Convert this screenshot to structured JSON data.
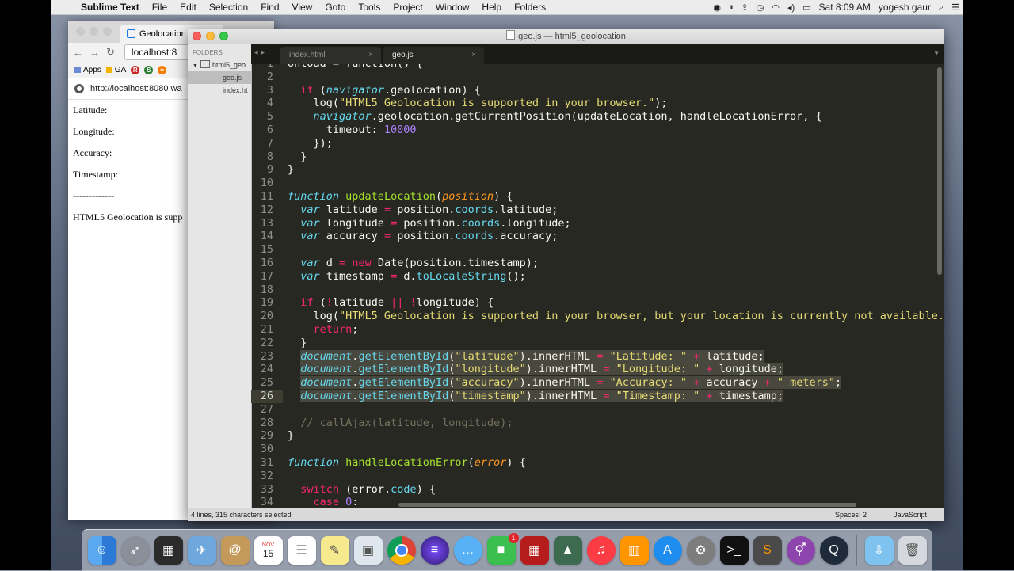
{
  "menubar": {
    "app": "Sublime Text",
    "items": [
      "File",
      "Edit",
      "Selection",
      "Find",
      "View",
      "Goto",
      "Tools",
      "Project",
      "Window",
      "Help",
      "Folders"
    ],
    "clock": "Sat 8:09 AM",
    "user": "yogesh gaur"
  },
  "browser": {
    "tab_title": "Geolocation",
    "url": "localhost:8",
    "bookmarks": {
      "apps": "Apps",
      "ga": "GA"
    },
    "infobar_text": "http://localhost:8080 wa",
    "fields": [
      "Latitude:",
      "Longitude:",
      "Accuracy:",
      "Timestamp:"
    ],
    "divider": "-------------",
    "message": "HTML5 Geolocation is supp"
  },
  "sublime": {
    "title": "geo.js — html5_geolocation",
    "sidebar": {
      "header": "FOLDERS",
      "folder": "html5_geo",
      "files": [
        "geo.js",
        "index.ht"
      ]
    },
    "tabs": [
      "index.html",
      "geo.js"
    ],
    "active_tab": "geo.js",
    "status": {
      "selection": "4 lines, 315 characters selected",
      "spaces": "Spaces: 2",
      "syntax": "JavaScript"
    },
    "line_numbers": [
      "1",
      "2",
      "3",
      "4",
      "5",
      "6",
      "7",
      "8",
      "9",
      "10",
      "11",
      "12",
      "13",
      "14",
      "15",
      "16",
      "17",
      "18",
      "19",
      "20",
      "21",
      "22",
      "23",
      "24",
      "25",
      "26",
      "27",
      "28",
      "29",
      "30",
      "31",
      "32",
      "33",
      "34"
    ]
  },
  "colors": {
    "editor_bg": "#272822",
    "keyword": "#f92672",
    "string": "#e6db74",
    "number": "#ae81ff",
    "function": "#a6e22e",
    "builtin": "#66d9ef",
    "comment": "#75715e"
  },
  "dock": {
    "icons": [
      "finder-icon",
      "launchpad-icon",
      "mission-control-icon",
      "preview-icon",
      "contacts-icon",
      "calendar-icon",
      "reminders-icon",
      "notes-icon",
      "photo-icon",
      "chrome-icon",
      "eclipse-icon",
      "messages-icon",
      "facetime-icon",
      "photo-booth-icon",
      "image-capture-icon",
      "itunes-icon",
      "ibooks-icon",
      "app-store-icon",
      "system-preferences-icon",
      "terminal-icon",
      "sublime-icon",
      "gender-icon",
      "quicktime-icon",
      "downloads-folder-icon",
      "trash-icon"
    ],
    "calendar_month": "NOV",
    "calendar_day": "15",
    "facetime_badge": "1"
  }
}
